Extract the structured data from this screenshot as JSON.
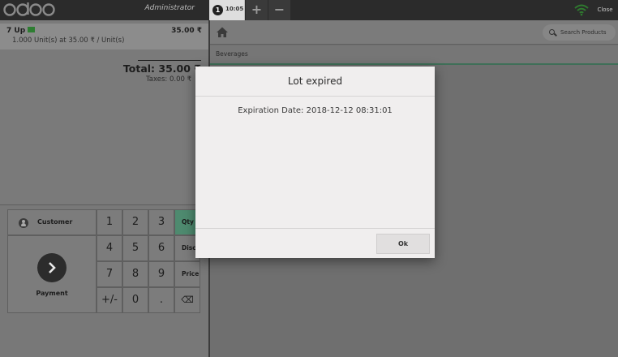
{
  "app": {
    "logo_text": "odoo",
    "user": "Administrator",
    "close_label": "Close"
  },
  "order_tab": {
    "number": "1",
    "time": "10:05",
    "add_label": "+",
    "remove_label": "−"
  },
  "order": {
    "lines": [
      {
        "product": "7 Up",
        "price": "35.00 ₹",
        "info": "1.000 Unit(s) at 35.00 ₹ / Unit(s)"
      }
    ],
    "total": "Total: 35.00 ₹",
    "taxes": "Taxes: 0.00 ₹"
  },
  "actionpad": {
    "customer": "Customer",
    "payment": "Payment"
  },
  "numpad": {
    "keys": [
      "1",
      "2",
      "3",
      "4",
      "5",
      "6",
      "7",
      "8",
      "9",
      "+/-",
      "0",
      "."
    ],
    "modes": [
      "Qty",
      "Disc",
      "Price"
    ],
    "backspace": "⌫",
    "active_mode": "Qty"
  },
  "products": {
    "search_placeholder": "Search Products",
    "breadcrumb": "Beverages"
  },
  "modal": {
    "title": "Lot expired",
    "body": "Expiration Date: 2018-12-12 08:31:01",
    "ok": "Ok"
  },
  "colors": {
    "topbar": "#2b2b2b",
    "accent_green": "#4e8a6f",
    "logo_purple": "#875a7b",
    "modal_bg": "#f0eeee"
  }
}
